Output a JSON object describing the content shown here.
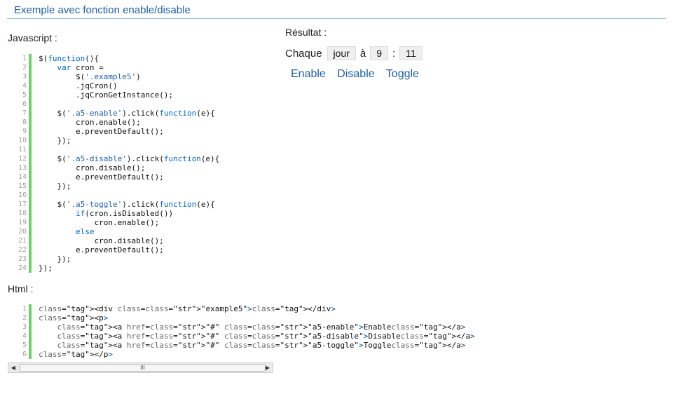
{
  "page": {
    "heading": "Exemple avec fonction enable/disable"
  },
  "sections": {
    "javascript_label": "Javascript :",
    "html_label": "Html :",
    "result_label": "Résultat :"
  },
  "javascript_code": {
    "line_numbers": [
      "1",
      "2",
      "3",
      "4",
      "5",
      "6",
      "7",
      "8",
      "9",
      "10",
      "11",
      "12",
      "13",
      "14",
      "15",
      "16",
      "17",
      "18",
      "19",
      "20",
      "21",
      "22",
      "23",
      "24"
    ],
    "lines": [
      "$(function(){",
      "    var cron =",
      "        $('.example5')",
      "        .jqCron()",
      "        .jqCronGetInstance();",
      "",
      "    $('.a5-enable').click(function(e){",
      "        cron.enable();",
      "        e.preventDefault();",
      "    });",
      "",
      "    $('.a5-disable').click(function(e){",
      "        cron.disable();",
      "        e.preventDefault();",
      "    });",
      "",
      "    $('.a5-toggle').click(function(e){",
      "        if(cron.isDisabled())",
      "            cron.enable();",
      "        else",
      "            cron.disable();",
      "        e.preventDefault();",
      "    });",
      "});"
    ]
  },
  "html_code": {
    "line_numbers": [
      "1",
      "2",
      "3",
      "4",
      "5",
      "6"
    ],
    "lines": [
      "<div class=\"example5\"></div>",
      "<p>",
      "    <a href=\"#\" class=\"a5-enable\">Enable</a>",
      "    <a href=\"#\" class=\"a5-disable\">Disable</a>",
      "    <a href=\"#\" class=\"a5-toggle\">Toggle</a>",
      "</p>"
    ],
    "scrollbar": {
      "left_arrow_icon": "◀",
      "right_arrow_icon": "▶",
      "thumb_grip": "III"
    }
  },
  "result": {
    "prefix": "Chaque",
    "period": "jour",
    "at": "à",
    "hour": "9",
    "colon": ":",
    "minute": "11",
    "links": {
      "enable": "Enable",
      "disable": "Disable",
      "toggle": "Toggle"
    }
  },
  "colors": {
    "accent": "#1e5fa8",
    "gutter_bar": "#6ccf6c"
  }
}
